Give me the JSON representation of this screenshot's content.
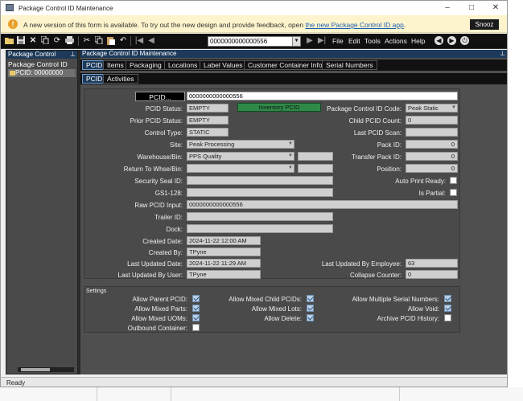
{
  "window": {
    "title": "Package Control ID Maintenance",
    "minimize": "–",
    "maximize": "□",
    "close": "✕"
  },
  "banner": {
    "icon": "!",
    "message": "A new version of this form is available. To try out the new design and provide feedback, open ",
    "link": "the new Package Control ID app",
    "message_end": ".",
    "snooze": "Snooz"
  },
  "toolbar": {
    "icons": [
      "folder-open-icon",
      "save-icon",
      "delete-icon",
      "copy-icon",
      "refresh-icon",
      "print-icon",
      "cut-icon",
      "copy-icon",
      "paste-icon",
      "undo-icon"
    ],
    "pcid_value": "0000000000000556",
    "nav_first": "|◀",
    "nav_prev": "◀",
    "nav_next": "▶",
    "nav_last": "▶|",
    "menus": [
      "File",
      "Edit",
      "Tools",
      "Actions",
      "Help"
    ]
  },
  "left_panel": {
    "title": "Package Control",
    "pin": "⊥",
    "tree_root": "Package Control ID",
    "tree_child": "PCID: 00000000"
  },
  "main": {
    "title": "Package Control ID Maintenance",
    "pin": "⊥",
    "tabs": [
      "PCID",
      "Items",
      "Packaging",
      "Locations",
      "Label Values",
      "Customer Container Info",
      "Serial Numbers"
    ],
    "subtabs": [
      "PCID",
      "Activities"
    ]
  },
  "form": {
    "pcid_button": "PCID...",
    "pcid_value": "0000000000000556",
    "pcid_status_label": "PCID Status:",
    "pcid_status": "EMPTY",
    "inventory_badge": "Inventory PCID",
    "prior_status_label": "Prior PCID Status:",
    "prior_status": "EMPTY",
    "control_type_label": "Control Type:",
    "control_type": "STATIC",
    "site_label": "Site:",
    "site": "Peak Processing",
    "warehouse_label": "Warehouse/Bin:",
    "warehouse": "PPS Quality",
    "return_label": "Return To Whse/Bin:",
    "return_value": "",
    "security_seal_label": "Security Seal ID:",
    "gs1_label": "GS1-128:",
    "raw_input_label": "Raw PCID Input:",
    "raw_input": "0000000000000556",
    "trailer_label": "Trailer ID:",
    "dock_label": "Dock:",
    "created_date_label": "Created Date:",
    "created_date": "2024-11-22 12:00 AM",
    "created_by_label": "Created By:",
    "created_by": "TPyne",
    "last_updated_date_label": "Last Updated Date:",
    "last_updated_date": "2024-11-22 11:29 AM",
    "last_updated_user_label": "Last Updated By User:",
    "last_updated_user": "TPyne",
    "pkg_code_label": "Package Control ID Code:",
    "pkg_code": "Peak Static",
    "child_count_label": "Child PCID Count:",
    "child_count": "0",
    "last_scan_label": "Last PCID Scan:",
    "pack_id_label": "Pack ID:",
    "pack_id": "0",
    "transfer_pack_label": "Transfer Pack ID:",
    "transfer_pack": "0",
    "position_label": "Position:",
    "position": "0",
    "auto_print_label": "Auto Print Ready:",
    "is_partial_label": "Is Partial:",
    "last_updated_emp_label": "Last Updated By Employee:",
    "last_updated_emp": "63",
    "collapse_label": "Collapse Counter:",
    "collapse": "0"
  },
  "settings": {
    "title": "Settings",
    "allow_parent": "Allow Parent PCID:",
    "allow_mixed_parts": "Allow Mixed Parts:",
    "allow_mixed_uoms": "Allow Mixed UOMs:",
    "outbound_container": "Outbound Container:",
    "allow_mixed_child": "Allow Mixed Child PCIDs:",
    "allow_mixed_lots": "Allow Mixed Lots:",
    "allow_delete": "Allow Delete:",
    "allow_multi_serial": "Allow Multiple Serial Numbers:",
    "allow_void": "Allow Void:",
    "archive_history": "Archive PCID History:"
  },
  "status": {
    "text": "Ready"
  }
}
